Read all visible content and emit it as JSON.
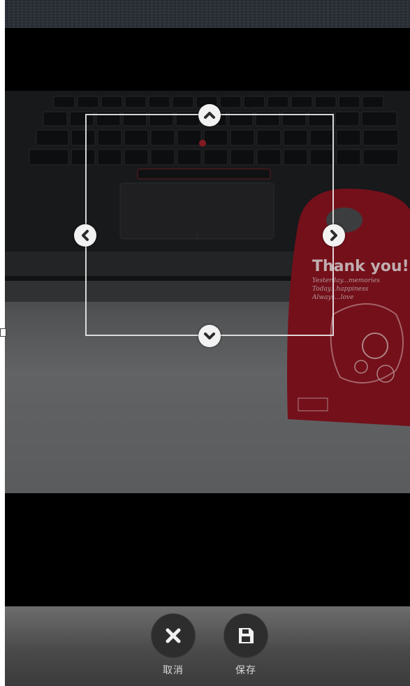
{
  "image": {
    "scene": "laptop keyboard and red gift bag",
    "bag_text": {
      "headline": "Thank you!",
      "line1": "Yesterday...memories",
      "line2": "Today...happiness",
      "line3": "Always...love"
    }
  },
  "crop": {
    "handles": [
      "arrow-up",
      "arrow-down",
      "arrow-left",
      "arrow-right"
    ]
  },
  "toolbar": {
    "cancel_label": "取消",
    "save_label": "保存"
  },
  "colors": {
    "bag_red": "#8e1420",
    "toolbar_bg": "#4a4a4a",
    "button_bg": "#2d2d2d"
  }
}
